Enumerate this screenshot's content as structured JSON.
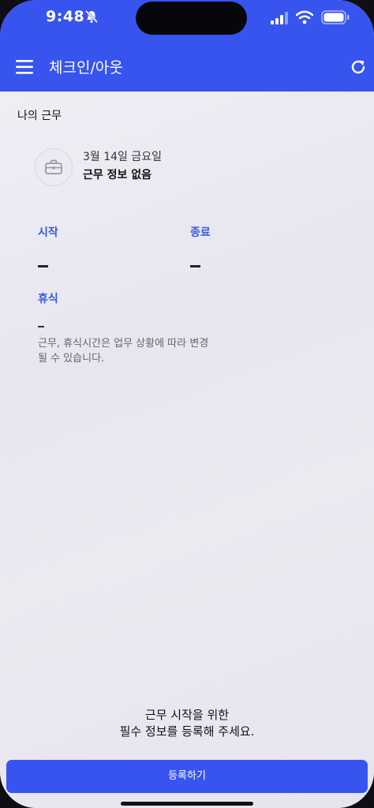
{
  "status_bar": {
    "time": "9:48",
    "icons": [
      "bell-muted-icon",
      "signal-icon",
      "wifi-icon",
      "battery-icon"
    ]
  },
  "app_bar": {
    "title": "체크인/아웃",
    "menu_icon": "menu-icon",
    "refresh_icon": "refresh-icon",
    "color": "#3754ef"
  },
  "my_work": {
    "section_title": "나의 근무",
    "icon": "briefcase-icon",
    "date": "3월 14일 금요일",
    "status": "근무 정보 없음"
  },
  "times": {
    "start_label": "시작",
    "end_label": "종료",
    "break_label": "휴식"
  },
  "note": "근무, 휴식시간은 업무 상황에 따라 변경될 수 있습니다.",
  "bottom": {
    "message_line1": "근무 시작을 위한",
    "message_line2": "필수 정보를 등록해 주세요.",
    "register_button": "등록하기"
  },
  "colors": {
    "accent": "#3754ef",
    "label_blue": "#3c58d8"
  }
}
